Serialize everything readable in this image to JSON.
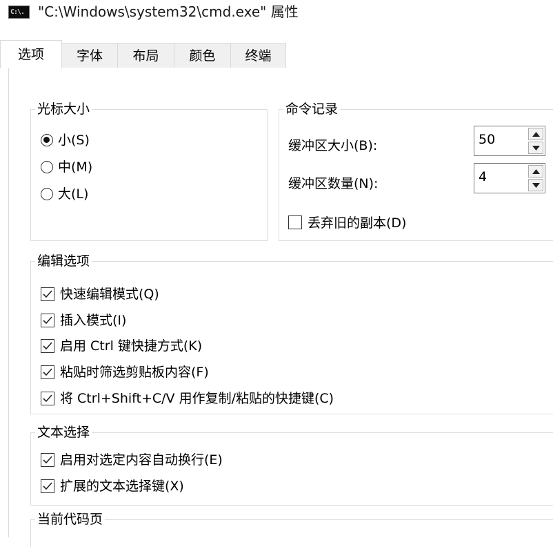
{
  "window": {
    "icon": "cmd-console-icon",
    "icon_text": "C:\\.",
    "title": "\"C:\\Windows\\system32\\cmd.exe\" 属性"
  },
  "tabs": [
    {
      "label": "选项",
      "active": true
    },
    {
      "label": "字体",
      "active": false
    },
    {
      "label": "布局",
      "active": false
    },
    {
      "label": "颜色",
      "active": false
    },
    {
      "label": "终端",
      "active": false
    }
  ],
  "cursor_size": {
    "legend": "光标大小",
    "options": [
      {
        "label": "小(S)",
        "selected": true
      },
      {
        "label": "中(M)",
        "selected": false
      },
      {
        "label": "大(L)",
        "selected": false
      }
    ]
  },
  "command_history": {
    "legend": "命令记录",
    "buffer_size": {
      "label": "缓冲区大小(B):",
      "value": "50"
    },
    "buffer_count": {
      "label": "缓冲区数量(N):",
      "value": "4"
    },
    "discard_old": {
      "label": "丢弃旧的副本(D)",
      "checked": false
    }
  },
  "edit_options": {
    "legend": "编辑选项",
    "items": [
      {
        "label": "快速编辑模式(Q)",
        "checked": true
      },
      {
        "label": "插入模式(I)",
        "checked": true
      },
      {
        "label": "启用 Ctrl 键快捷方式(K)",
        "checked": true
      },
      {
        "label": "粘贴时筛选剪贴板内容(F)",
        "checked": true
      },
      {
        "label": "将 Ctrl+Shift+C/V 用作复制/粘贴的快捷键(C)",
        "checked": true
      }
    ]
  },
  "text_selection": {
    "legend": "文本选择",
    "items": [
      {
        "label": "启用对选定内容自动换行(E)",
        "checked": true
      },
      {
        "label": "扩展的文本选择键(X)",
        "checked": true
      }
    ]
  },
  "code_page": {
    "legend": "当前代码页"
  }
}
